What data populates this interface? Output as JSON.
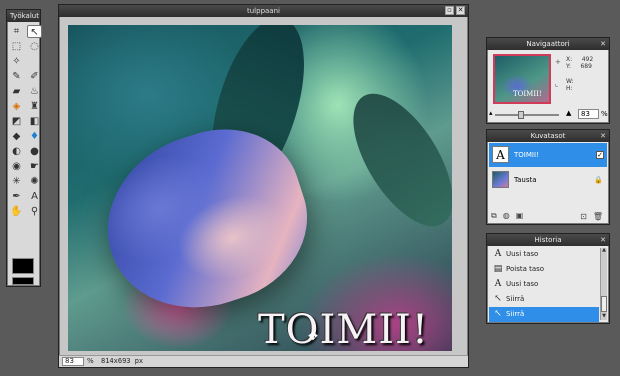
{
  "tools_panel": {
    "title": "Työkalut",
    "tools": [
      {
        "icon": "crop-icon",
        "glyph": "⌗"
      },
      {
        "icon": "move-icon",
        "glyph": "↖"
      },
      {
        "icon": "marquee-icon",
        "glyph": "⬚"
      },
      {
        "icon": "lasso-icon",
        "glyph": "◌"
      },
      {
        "icon": "wand-icon",
        "glyph": "✧"
      },
      {
        "icon": "blank-icon",
        "glyph": ""
      },
      {
        "icon": "pencil-icon",
        "glyph": "✎"
      },
      {
        "icon": "brush-icon",
        "glyph": "✐"
      },
      {
        "icon": "eraser-icon",
        "glyph": "▰"
      },
      {
        "icon": "spray-icon",
        "glyph": "♨"
      },
      {
        "icon": "bucket-icon",
        "glyph": "◈"
      },
      {
        "icon": "stamp-icon",
        "glyph": "♜"
      },
      {
        "icon": "gradient-icon",
        "glyph": "◩"
      },
      {
        "icon": "replace-icon",
        "glyph": "◧"
      },
      {
        "icon": "blur-icon",
        "glyph": "◆"
      },
      {
        "icon": "drop-icon",
        "glyph": "♦"
      },
      {
        "icon": "dodge-icon",
        "glyph": "◐"
      },
      {
        "icon": "sponge-icon",
        "glyph": "●"
      },
      {
        "icon": "redeye-icon",
        "glyph": "◉"
      },
      {
        "icon": "smudge-icon",
        "glyph": "☛"
      },
      {
        "icon": "pinch-icon",
        "glyph": "✳"
      },
      {
        "icon": "bloat-icon",
        "glyph": "✺"
      },
      {
        "icon": "picker-icon",
        "glyph": "✒"
      },
      {
        "icon": "type-icon",
        "glyph": "A"
      },
      {
        "icon": "hand-icon",
        "glyph": "✋"
      },
      {
        "icon": "zoom-icon",
        "glyph": "⚲"
      }
    ],
    "primary_color": "#000000",
    "secondary_color": "#000000"
  },
  "main_window": {
    "title": "tulppaani",
    "canvas_text": "TOIMII!",
    "zoom": "83",
    "zoom_unit": "%",
    "image_size": "814x693 px"
  },
  "navigator": {
    "title": "Navigaattori",
    "thumb_text": "TOIMII!",
    "x_label": "X:",
    "x_value": "492",
    "y_label": "Y:",
    "y_value": "689",
    "w_label": "W:",
    "h_label": "H:",
    "zoom": "83",
    "zoom_unit": "%",
    "zoom_level": 0.4
  },
  "layers": {
    "title": "Kuvatasot",
    "items": [
      {
        "name": "TOIMII!",
        "thumb": "A",
        "selected": true,
        "visible": "✓"
      },
      {
        "name": "Tausta",
        "thumb": "",
        "selected": false,
        "locked": "🔒"
      }
    ]
  },
  "history": {
    "title": "Historia",
    "items": [
      {
        "label": "Uusi taso",
        "icon": "A"
      },
      {
        "label": "Poista taso",
        "icon": "▤"
      },
      {
        "label": "Uusi taso",
        "icon": "A"
      },
      {
        "label": "Siirrä",
        "icon": "↖"
      },
      {
        "label": "Siirrä",
        "icon": "↖",
        "selected": true
      }
    ]
  }
}
